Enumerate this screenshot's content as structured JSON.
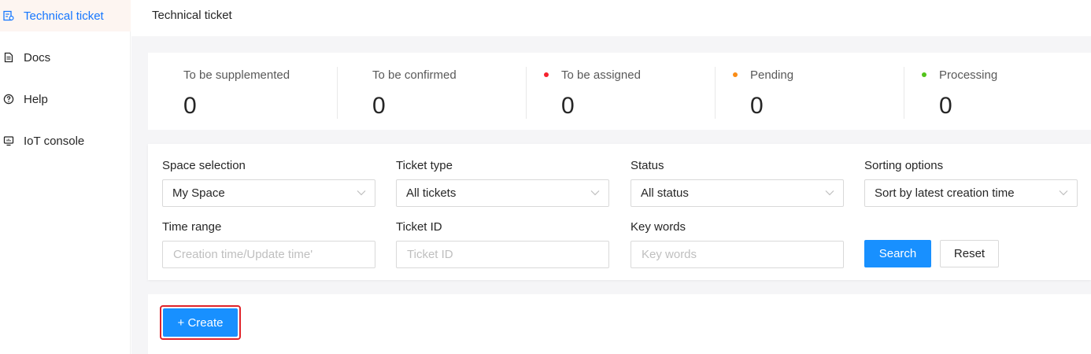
{
  "sidebar": {
    "items": [
      {
        "label": "Technical ticket",
        "icon": "ticket-icon",
        "active": true
      },
      {
        "label": "Docs",
        "icon": "document-icon",
        "active": false
      },
      {
        "label": "Help",
        "icon": "help-icon",
        "active": false
      },
      {
        "label": "IoT console",
        "icon": "console-icon",
        "active": false
      }
    ]
  },
  "header": {
    "title": "Technical ticket"
  },
  "stats": [
    {
      "label": "To be supplemented",
      "value": "0",
      "dot": null
    },
    {
      "label": "To be confirmed",
      "value": "0",
      "dot": null
    },
    {
      "label": "To be assigned",
      "value": "0",
      "dot": "#f5222d"
    },
    {
      "label": "Pending",
      "value": "0",
      "dot": "#fa8c16"
    },
    {
      "label": "Processing",
      "value": "0",
      "dot": "#52c41a"
    }
  ],
  "filters": {
    "space": {
      "label": "Space selection",
      "value": "My Space"
    },
    "ticket_type": {
      "label": "Ticket type",
      "value": "All tickets"
    },
    "status": {
      "label": "Status",
      "value": "All status"
    },
    "sorting": {
      "label": "Sorting options",
      "value": "Sort by latest creation time"
    },
    "time_range": {
      "label": "Time range",
      "placeholder": "Creation time/Update time'"
    },
    "ticket_id": {
      "label": "Ticket ID",
      "placeholder": "Ticket ID"
    },
    "keywords": {
      "label": "Key words",
      "placeholder": "Key words"
    },
    "search_label": "Search",
    "reset_label": "Reset"
  },
  "actions": {
    "create_label": "+ Create"
  },
  "colors": {
    "accent": "#1890ff",
    "highlight": "#e0232a"
  }
}
